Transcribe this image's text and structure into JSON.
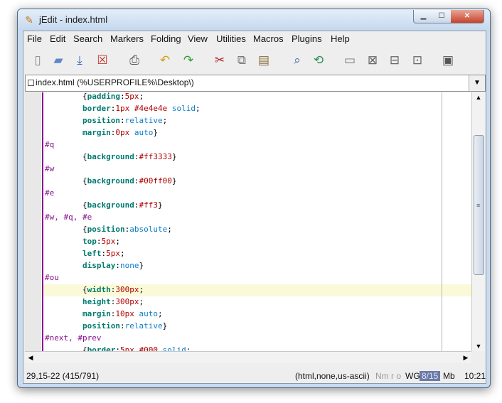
{
  "window": {
    "title": "jEdit - index.html"
  },
  "menubar": [
    "File",
    "Edit",
    "Search",
    "Markers",
    "Folding",
    "View",
    "Utilities",
    "Macros",
    "Plugins",
    "Help"
  ],
  "toolbar": [
    "new-file-icon",
    "open-file-icon",
    "save-file-icon",
    "close-file-icon",
    "print-icon",
    "undo-icon",
    "redo-icon",
    "cut-icon",
    "copy-icon",
    "paste-icon",
    "find-icon",
    "find-in-files-icon",
    "new-view-icon",
    "split-horizontal-icon",
    "split-vertical-icon",
    "unsplit-icon",
    "global-options-icon"
  ],
  "buffer": {
    "name": "index.html (%USERPROFILE%\\Desktop\\)"
  },
  "code_lines": [
    [
      [
        "pl",
        "        {"
      ],
      [
        "pr",
        "padding"
      ],
      [
        "pl",
        ":"
      ],
      [
        "val",
        "5px"
      ],
      [
        "pl",
        ";"
      ]
    ],
    [
      [
        "pl",
        "        "
      ],
      [
        "pr",
        "border"
      ],
      [
        "pl",
        ":"
      ],
      [
        "val",
        "1px #4e4e4e"
      ],
      [
        "pl",
        " "
      ],
      [
        "kw",
        "solid"
      ],
      [
        "pl",
        ";"
      ]
    ],
    [
      [
        "pl",
        "        "
      ],
      [
        "pr",
        "position"
      ],
      [
        "pl",
        ":"
      ],
      [
        "kw",
        "relative"
      ],
      [
        "pl",
        ";"
      ]
    ],
    [
      [
        "pl",
        "        "
      ],
      [
        "pr",
        "margin"
      ],
      [
        "pl",
        ":"
      ],
      [
        "val",
        "0px"
      ],
      [
        "pl",
        " "
      ],
      [
        "kw",
        "auto"
      ],
      [
        "pl",
        "}"
      ]
    ],
    [
      [
        "sel",
        "#q"
      ]
    ],
    [
      [
        "pl",
        "        {"
      ],
      [
        "pr",
        "background"
      ],
      [
        "pl",
        ":"
      ],
      [
        "val",
        "#ff3333"
      ],
      [
        "pl",
        "}"
      ]
    ],
    [
      [
        "sel",
        "#w"
      ]
    ],
    [
      [
        "pl",
        "        {"
      ],
      [
        "pr",
        "background"
      ],
      [
        "pl",
        ":"
      ],
      [
        "val",
        "#00ff00"
      ],
      [
        "pl",
        "}"
      ]
    ],
    [
      [
        "sel",
        "#e"
      ]
    ],
    [
      [
        "pl",
        "        {"
      ],
      [
        "pr",
        "background"
      ],
      [
        "pl",
        ":"
      ],
      [
        "val",
        "#ff3"
      ],
      [
        "pl",
        "}"
      ]
    ],
    [
      [
        "sel",
        "#w, #q, #e"
      ]
    ],
    [
      [
        "pl",
        "        {"
      ],
      [
        "pr",
        "position"
      ],
      [
        "pl",
        ":"
      ],
      [
        "kw",
        "absolute"
      ],
      [
        "pl",
        ";"
      ]
    ],
    [
      [
        "pl",
        "        "
      ],
      [
        "pr",
        "top"
      ],
      [
        "pl",
        ":"
      ],
      [
        "val",
        "5px"
      ],
      [
        "pl",
        ";"
      ]
    ],
    [
      [
        "pl",
        "        "
      ],
      [
        "pr",
        "left"
      ],
      [
        "pl",
        ":"
      ],
      [
        "val",
        "5px"
      ],
      [
        "pl",
        ";"
      ]
    ],
    [
      [
        "pl",
        "        "
      ],
      [
        "pr",
        "display"
      ],
      [
        "pl",
        ":"
      ],
      [
        "kw",
        "none"
      ],
      [
        "pl",
        "}"
      ]
    ],
    [
      [
        "sel",
        "#ou"
      ]
    ],
    [
      [
        "pl",
        "        {"
      ],
      [
        "pr",
        "width"
      ],
      [
        "pl",
        ":"
      ],
      [
        "val",
        "300px"
      ],
      [
        "pl",
        ";"
      ]
    ],
    [
      [
        "pl",
        "        "
      ],
      [
        "pr",
        "height"
      ],
      [
        "pl",
        ":"
      ],
      [
        "val",
        "300px"
      ],
      [
        "pl",
        ";"
      ]
    ],
    [
      [
        "pl",
        "        "
      ],
      [
        "pr",
        "margin"
      ],
      [
        "pl",
        ":"
      ],
      [
        "val",
        "10px"
      ],
      [
        "pl",
        " "
      ],
      [
        "kw",
        "auto"
      ],
      [
        "pl",
        ";"
      ]
    ],
    [
      [
        "pl",
        "        "
      ],
      [
        "pr",
        "position"
      ],
      [
        "pl",
        ":"
      ],
      [
        "kw",
        "relative"
      ],
      [
        "pl",
        "}"
      ]
    ],
    [
      [
        "sel",
        "#next, #prev"
      ]
    ],
    [
      [
        "pl",
        "        {"
      ],
      [
        "pr",
        "border"
      ],
      [
        "pl",
        ":"
      ],
      [
        "val",
        "5px #000"
      ],
      [
        "pl",
        " "
      ],
      [
        "kw",
        "solid"
      ],
      [
        "pl",
        ";"
      ]
    ]
  ],
  "status": {
    "caret": "29,15-22 (415/791)",
    "mode": "(html,none,us-ascii)",
    "flags": "Nm r o",
    "wrap": "WG",
    "memory": "8/15",
    "memory_unit": "Mb",
    "clock": "10:21"
  },
  "colors": {
    "property": "#007a6e",
    "selector": "#8a0e8f",
    "value": "#b00000",
    "keyword": "#0a7cc7",
    "current_line": "#fafad8"
  }
}
